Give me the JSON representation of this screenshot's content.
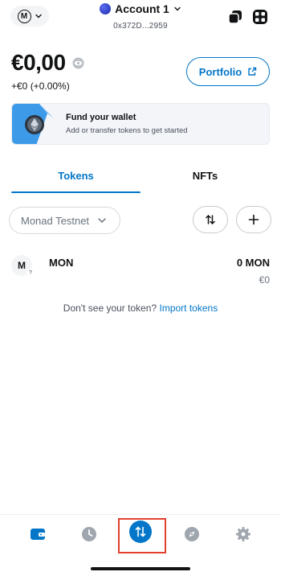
{
  "header": {
    "network_avatar_letter": "M",
    "account_name": "Account 1",
    "account_address": "0x372D...2959"
  },
  "balance": {
    "value": "€0,00",
    "change": "+€0 (+0.00%)",
    "portfolio_label": "Portfolio"
  },
  "fund_card": {
    "title": "Fund your wallet",
    "subtitle": "Add or transfer tokens to get started"
  },
  "tabs": [
    {
      "label": "Tokens",
      "active": true
    },
    {
      "label": "NFTs",
      "active": false
    }
  ],
  "filter": {
    "network_label": "Monad Testnet"
  },
  "tokens": [
    {
      "avatar_letter": "M",
      "badge": "?",
      "name": "MON",
      "amount": "0 MON",
      "fiat": "€0"
    }
  ],
  "import_hint": {
    "text": "Don't see your token? ",
    "link": "Import tokens"
  },
  "bottom_nav": {
    "items": [
      "wallet-icon",
      "activity-icon",
      "swap-icon",
      "explore-icon",
      "settings-icon"
    ],
    "highlighted": "swap-icon"
  },
  "colors": {
    "accent": "#0376c9",
    "highlight": "#e0402f",
    "text": "#121314"
  }
}
